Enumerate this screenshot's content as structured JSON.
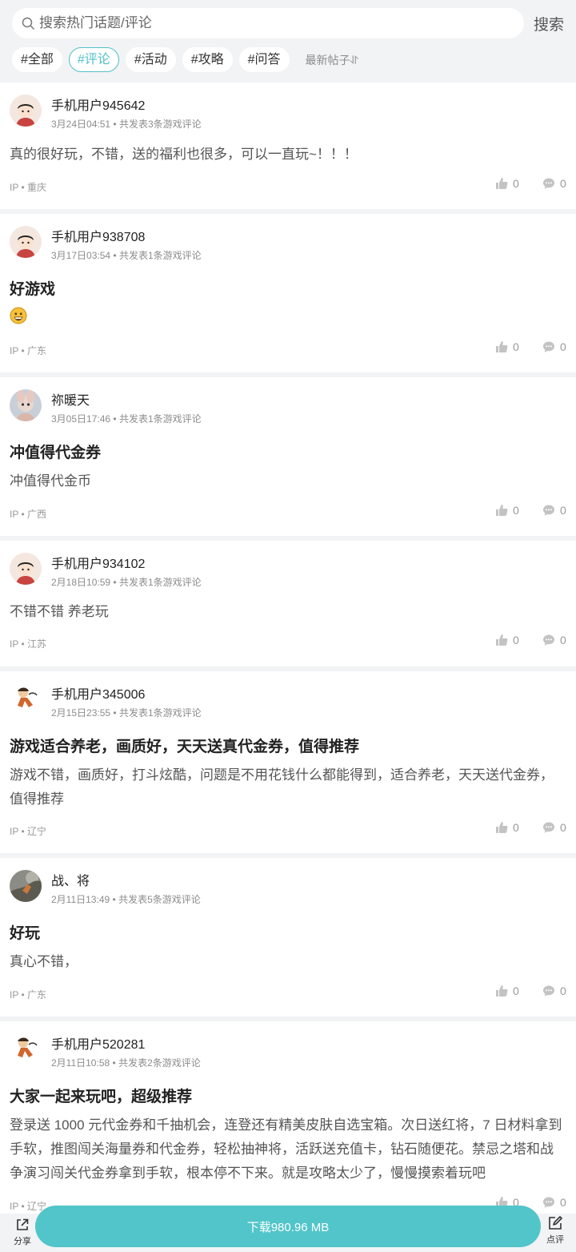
{
  "search": {
    "placeholder": "搜索热门话题/评论",
    "button": "搜索"
  },
  "filters": [
    "#全部",
    "#评论",
    "#活动",
    "#攻略",
    "#问答"
  ],
  "active_filter": 1,
  "sort_label": "最新帖子⥯",
  "posts": [
    {
      "user": "手机用户945642",
      "time": "3月24日04:51",
      "count": "共发表3条游戏评论",
      "title": "",
      "body": "真的很好玩，不错，送的福利也很多，可以一直玩~！！！",
      "emoji": "",
      "ip": "IP",
      "location": "重庆",
      "likes": "0",
      "comments": "0"
    },
    {
      "user": "手机用户938708",
      "time": "3月17日03:54",
      "count": "共发表1条游戏评论",
      "title": "好游戏",
      "body": "",
      "emoji": "grinning-face",
      "ip": "IP",
      "location": "广东",
      "likes": "0",
      "comments": "0"
    },
    {
      "user": "祢暖天",
      "time": "3月05日17:46",
      "count": "共发表1条游戏评论",
      "title": "冲值得代金券",
      "body": "冲值得代金币",
      "emoji": "",
      "ip": "IP",
      "location": "广西",
      "likes": "0",
      "comments": "0"
    },
    {
      "user": "手机用户934102",
      "time": "2月18日10:59",
      "count": "共发表1条游戏评论",
      "title": "",
      "body": "不错不错 养老玩",
      "emoji": "",
      "ip": "IP",
      "location": "江苏",
      "likes": "0",
      "comments": "0"
    },
    {
      "user": "手机用户345006",
      "time": "2月15日23:55",
      "count": "共发表1条游戏评论",
      "title": "游戏适合养老，画质好，天天送真代金券，值得推荐",
      "body": "游戏不错，画质好，打斗炫酷，问题是不用花钱什么都能得到，适合养老，天天送代金券，值得推荐",
      "emoji": "",
      "ip": "IP",
      "location": "辽宁",
      "likes": "0",
      "comments": "0"
    },
    {
      "user": "战、将",
      "time": "2月11日13:49",
      "count": "共发表5条游戏评论",
      "title": "好玩",
      "body": "真心不错，",
      "emoji": "",
      "ip": "IP",
      "location": "广东",
      "likes": "0",
      "comments": "0"
    },
    {
      "user": "手机用户520281",
      "time": "2月11日10:58",
      "count": "共发表2条游戏评论",
      "title": "大家一起来玩吧，超级推荐",
      "body": "登录送 1000 元代金券和千抽机会，连登还有精美皮肤自选宝箱。次日送红将，7 日材料拿到手软，推图闯关海量券和代金券，轻松抽神将，活跃送充值卡，钻石随便花。禁忌之塔和战争演习闯关代金券拿到手软，根本停不下来。就是攻略太少了，慢慢摸索着玩吧",
      "emoji": "",
      "ip": "IP",
      "location": "辽宁",
      "likes": "0",
      "comments": "0"
    }
  ],
  "separator": "•",
  "bottom": {
    "share": "分享",
    "download": "下载980.96 MB",
    "review": "点评"
  },
  "colors": {
    "accent": "#52c5ca",
    "background": "#f2f3f5"
  }
}
